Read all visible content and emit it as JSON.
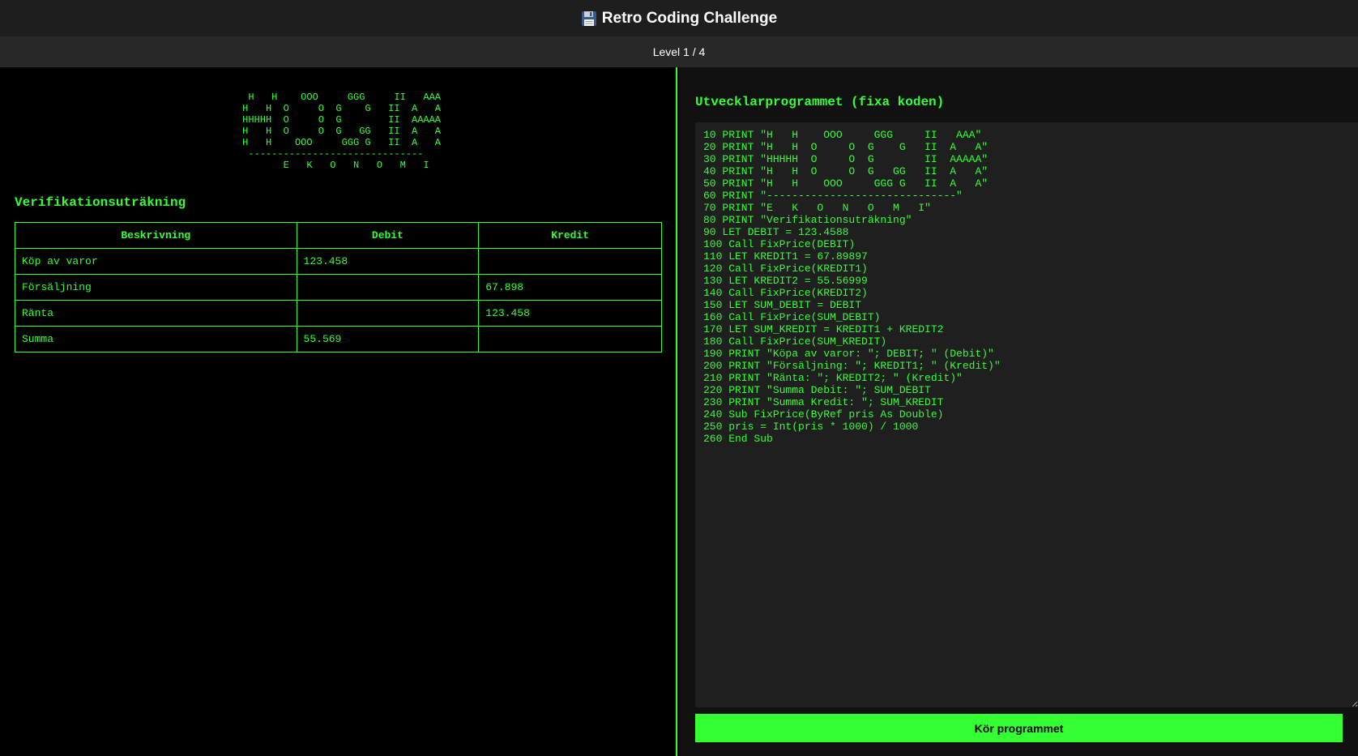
{
  "header": {
    "icon": "floppy-disk-icon",
    "title": "Retro Coding Challenge"
  },
  "level": {
    "text": "Level 1 / 4"
  },
  "left_panel": {
    "ascii_logo": "  H   H    OOO     GGG     II   AAA\n H   H  O     O  G    G   II  A   A\n HHHHH  O     O  G        II  AAAAA\n H   H  O     O  G   GG   II  A   A\n H   H    OOO     GGG G   II  A   A\n  ------------------------------\n        E   K   O   N   O   M   I",
    "section_title": "Verifikationsuträkning",
    "table": {
      "headers": [
        "Beskrivning",
        "Debit",
        "Kredit"
      ],
      "rows": [
        [
          "Köp av varor",
          "123.458",
          ""
        ],
        [
          "Försäljning",
          "",
          "67.898"
        ],
        [
          "Ränta",
          "",
          "123.458"
        ],
        [
          "Summa",
          "55.569",
          ""
        ]
      ]
    }
  },
  "right_panel": {
    "title": "Utvecklarprogrammet (fixa koden)",
    "code": "10 PRINT \"H   H    OOO     GGG     II   AAA\"\n20 PRINT \"H   H  O     O  G    G   II  A   A\"\n30 PRINT \"HHHHH  O     O  G        II  AAAAA\"\n40 PRINT \"H   H  O     O  G   GG   II  A   A\"\n50 PRINT \"H   H    OOO     GGG G   II  A   A\"\n60 PRINT \"------------------------------\"\n70 PRINT \"E   K   O   N   O   M   I\"\n80 PRINT \"Verifikationsuträkning\"\n90 LET DEBIT = 123.4588\n100 Call FixPrice(DEBIT)\n110 LET KREDIT1 = 67.89897\n120 Call FixPrice(KREDIT1)\n130 LET KREDIT2 = 55.56999\n140 Call FixPrice(KREDIT2)\n150 LET SUM_DEBIT = DEBIT\n160 Call FixPrice(SUM_DEBIT)\n170 LET SUM_KREDIT = KREDIT1 + KREDIT2\n180 Call FixPrice(SUM_KREDIT)\n190 PRINT \"Köpa av varor: \"; DEBIT; \" (Debit)\"\n200 PRINT \"Försäljning: \"; KREDIT1; \" (Kredit)\"\n210 PRINT \"Ränta: \"; KREDIT2; \" (Kredit)\"\n220 PRINT \"Summa Debit: \"; SUM_DEBIT\n230 PRINT \"Summa Kredit: \"; SUM_KREDIT\n240 Sub FixPrice(ByRef pris As Double)\n250 pris = Int(pris * 1000) / 1000\n260 End Sub",
    "run_button": "Kör programmet"
  },
  "colors": {
    "accent": "#33ff33",
    "background": "#000000",
    "header_bg": "#1e1e1e",
    "editor_bg": "#1f1f1f"
  }
}
